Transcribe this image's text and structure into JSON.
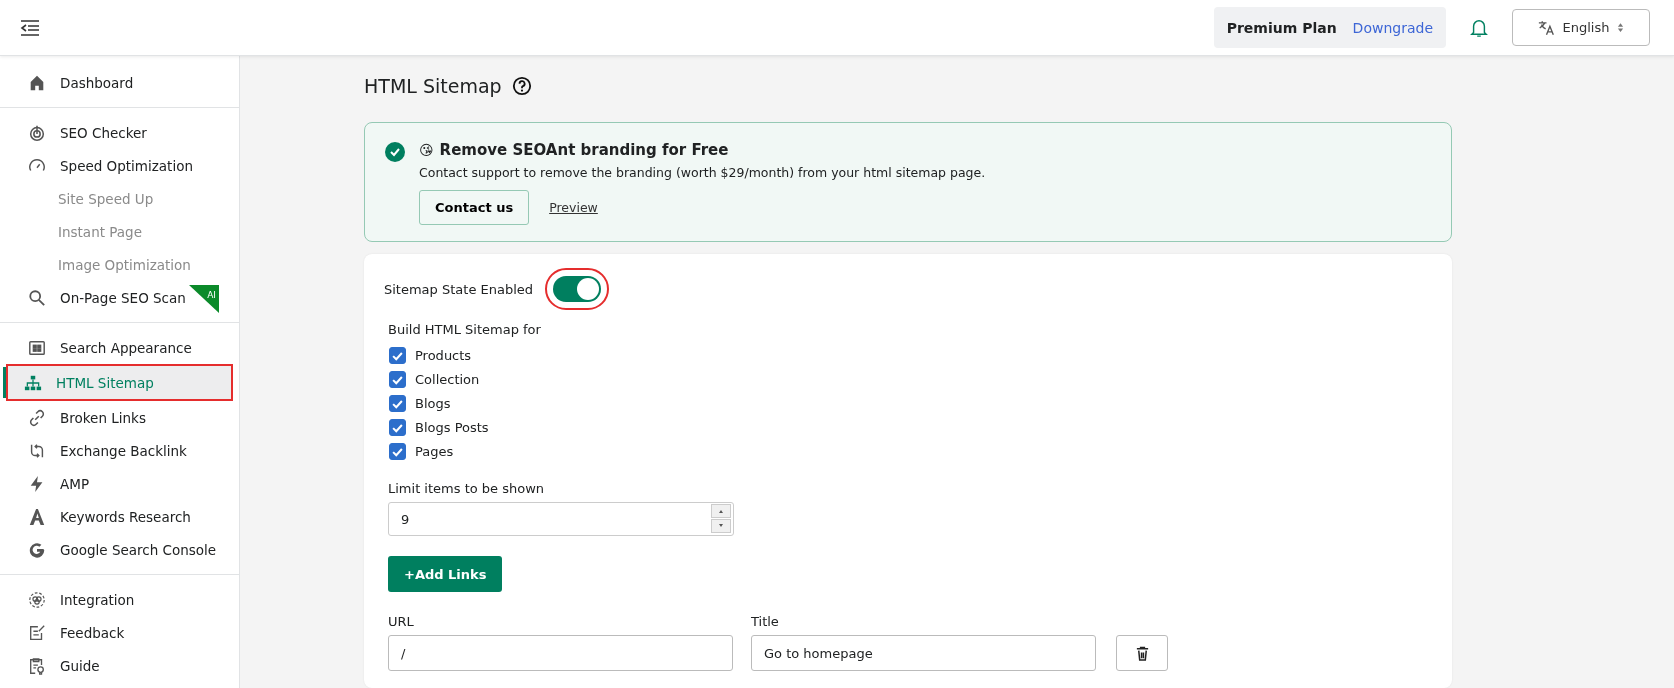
{
  "header": {
    "plan": "Premium Plan",
    "downgrade": "Downgrade",
    "language": "English"
  },
  "sidebar": {
    "groups": [
      [
        {
          "label": "Dashboard",
          "kind": "main",
          "selected": false
        }
      ],
      [
        {
          "label": "SEO Checker",
          "kind": "main",
          "selected": false
        },
        {
          "label": "Speed Optimization",
          "kind": "main",
          "selected": false
        },
        {
          "label": "Site Speed Up",
          "kind": "sub",
          "selected": false
        },
        {
          "label": "Instant Page",
          "kind": "sub",
          "selected": false
        },
        {
          "label": "Image Optimization",
          "kind": "sub",
          "selected": false
        },
        {
          "label": "On-Page SEO Scan",
          "kind": "main",
          "selected": false,
          "badge": "AI"
        }
      ],
      [
        {
          "label": "Search Appearance",
          "kind": "main",
          "selected": false
        },
        {
          "label": "HTML Sitemap",
          "kind": "main",
          "selected": true,
          "highlighted": true
        },
        {
          "label": "Broken Links",
          "kind": "main",
          "selected": false
        },
        {
          "label": "Exchange Backlink",
          "kind": "main",
          "selected": false
        },
        {
          "label": "AMP",
          "kind": "main",
          "selected": false
        },
        {
          "label": "Keywords Research",
          "kind": "main",
          "selected": false
        },
        {
          "label": "Google Search Console",
          "kind": "main",
          "selected": false
        }
      ],
      [
        {
          "label": "Integration",
          "kind": "main",
          "selected": false
        },
        {
          "label": "Feedback",
          "kind": "main",
          "selected": false
        },
        {
          "label": "Guide",
          "kind": "main",
          "selected": false
        }
      ]
    ]
  },
  "page": {
    "title": "HTML Sitemap"
  },
  "banner": {
    "emoji": "😘",
    "title": "Remove SEOAnt branding for Free",
    "text": "Contact support to remove the branding (worth $29/month) from your html sitemap page.",
    "button": "Contact us",
    "link": "Preview"
  },
  "settings": {
    "toggle_label": "Sitemap State Enabled",
    "enabled": true,
    "toggle_highlighted": true,
    "build_label": "Build HTML Sitemap for",
    "options": [
      {
        "label": "Products",
        "checked": true
      },
      {
        "label": "Collection",
        "checked": true
      },
      {
        "label": "Blogs",
        "checked": true
      },
      {
        "label": "Blogs Posts",
        "checked": true
      },
      {
        "label": "Pages",
        "checked": true
      }
    ],
    "limit_label": "Limit items to be shown",
    "limit_value": "9",
    "add_button": "+Add Links",
    "url_label": "URL",
    "title_label": "Title",
    "links": [
      {
        "url": "/",
        "title": "Go to homepage"
      }
    ]
  }
}
